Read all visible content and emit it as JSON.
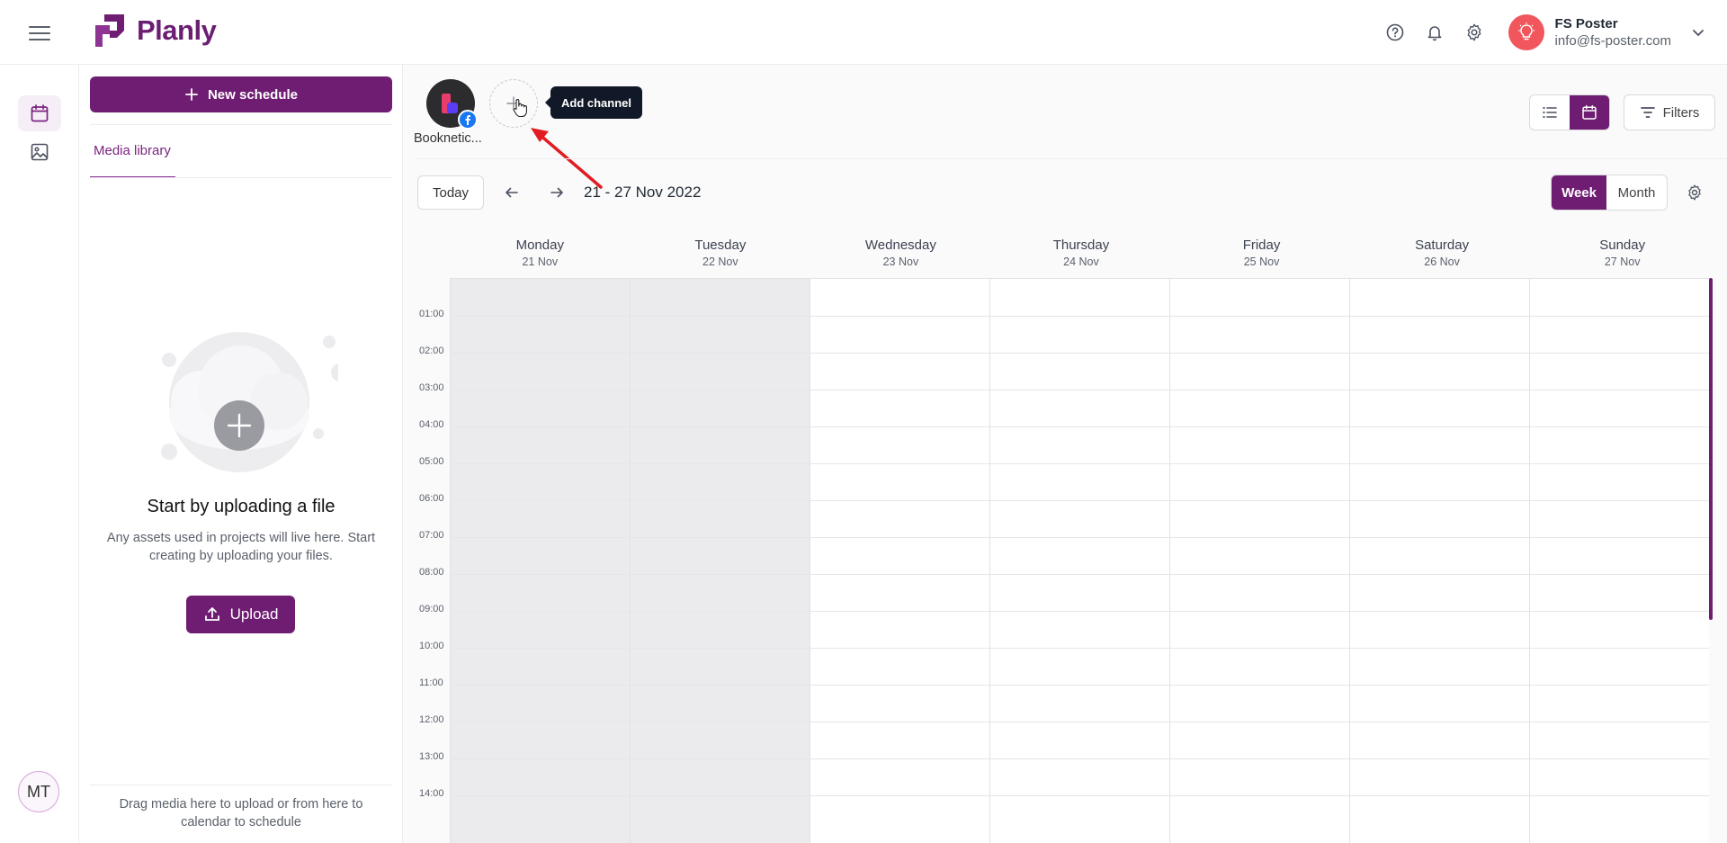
{
  "brand": {
    "name": "Planly",
    "color": "#6f1d72"
  },
  "header": {
    "help_icon": "help-circle-icon",
    "notifications_icon": "bell-icon",
    "settings_icon": "gear-icon",
    "user": {
      "name": "FS Poster",
      "email": "info@fs-poster.com"
    }
  },
  "sidebar": {
    "items": [
      {
        "name": "calendar",
        "icon": "calendar-icon",
        "active": true
      },
      {
        "name": "media",
        "icon": "image-icon",
        "active": false
      }
    ],
    "user_initials": "MT"
  },
  "media_panel": {
    "new_schedule_label": "New schedule",
    "tab_label": "Media library",
    "empty_title": "Start by uploading a file",
    "empty_description": "Any assets used in projects will live here. Start creating by uploading your files.",
    "upload_label": "Upload",
    "drag_hint": "Drag media here to upload or from here to calendar to schedule"
  },
  "channels": {
    "items": [
      {
        "name": "Booknetic...",
        "network": "facebook"
      }
    ],
    "add_tooltip": "Add channel"
  },
  "toolbar": {
    "filters_label": "Filters",
    "view_modes": [
      "list",
      "calendar"
    ],
    "active_view": "calendar"
  },
  "calendar": {
    "today_label": "Today",
    "range_label": "21 - 27 Nov 2022",
    "week_label": "Week",
    "month_label": "Month",
    "days": [
      {
        "name": "Monday",
        "date": "21 Nov",
        "past": true
      },
      {
        "name": "Tuesday",
        "date": "22 Nov",
        "past": true
      },
      {
        "name": "Wednesday",
        "date": "23 Nov",
        "past": false
      },
      {
        "name": "Thursday",
        "date": "24 Nov",
        "past": false
      },
      {
        "name": "Friday",
        "date": "25 Nov",
        "past": false
      },
      {
        "name": "Saturday",
        "date": "26 Nov",
        "past": false
      },
      {
        "name": "Sunday",
        "date": "27 Nov",
        "past": false
      }
    ],
    "hours": [
      "01:00",
      "02:00",
      "03:00",
      "04:00",
      "05:00",
      "06:00",
      "07:00",
      "08:00",
      "09:00",
      "10:00",
      "11:00",
      "12:00",
      "13:00",
      "14:00"
    ]
  }
}
